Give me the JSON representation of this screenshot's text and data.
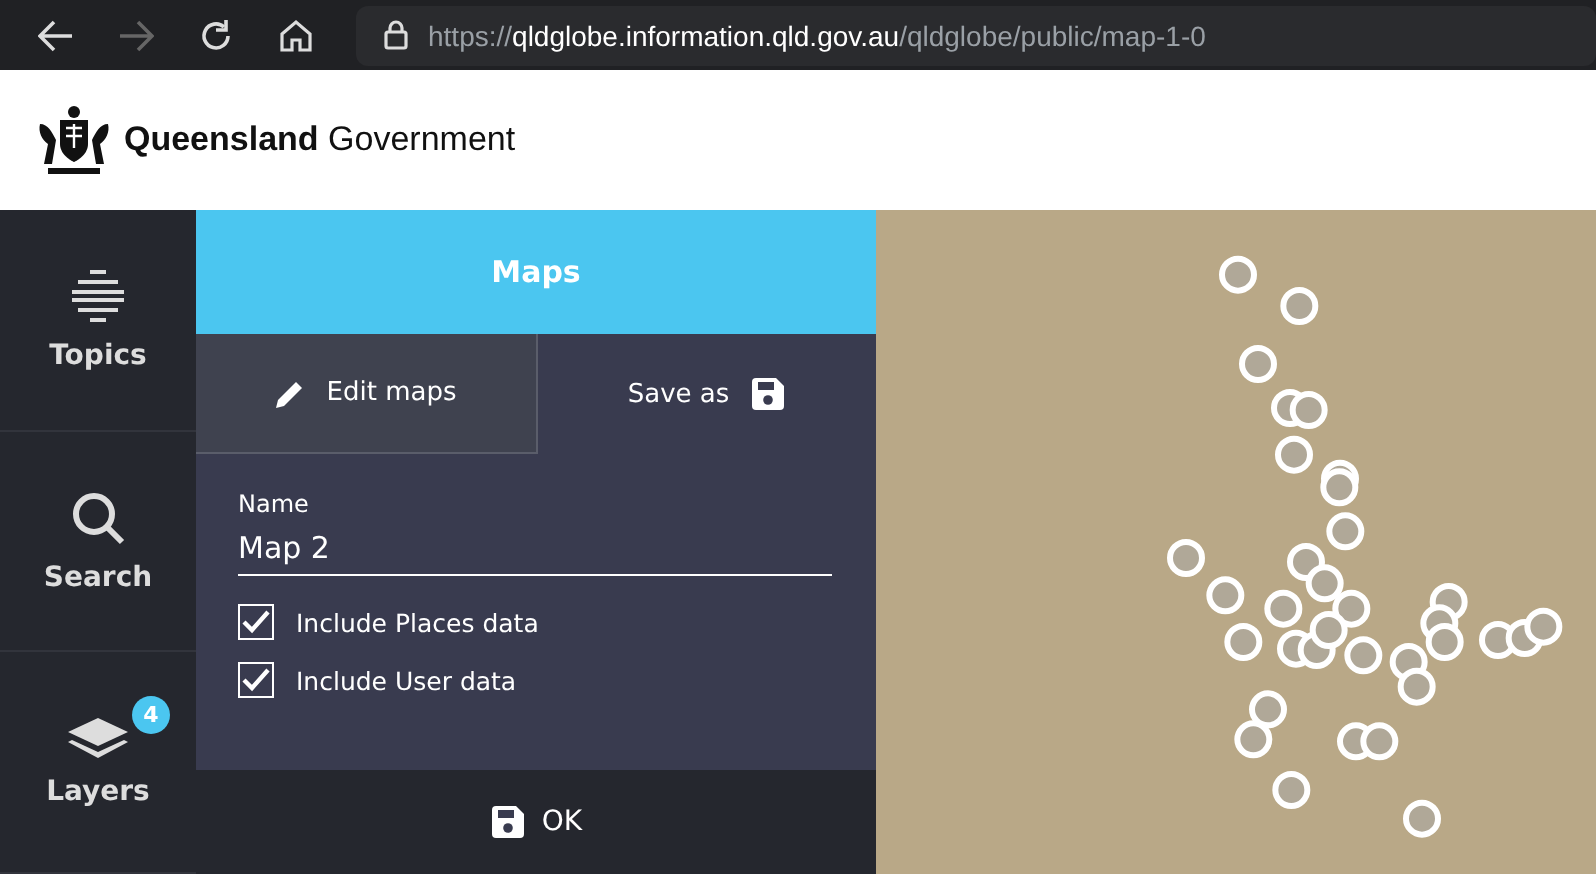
{
  "browser": {
    "url": "https://**qldglobe.information.qld.gov.au**/qldglobe/public/map-1-0",
    "forward_disabled": true
  },
  "header": {
    "brand_bold": "Queensland",
    "brand_light": "Government"
  },
  "nav": [
    {
      "kind": "topics",
      "label": "Topics"
    },
    {
      "kind": "search",
      "label": "Search"
    },
    {
      "kind": "layers",
      "label": "Layers",
      "badge": "4"
    }
  ],
  "panel": {
    "title": "Maps",
    "tabs": [
      {
        "kind": "edit",
        "label": "Edit maps",
        "selected": true
      },
      {
        "kind": "save",
        "label": "Save as",
        "selected": false
      }
    ],
    "name_label": "Name",
    "name_value": "Map 2",
    "options": [
      {
        "label": "Include Places data",
        "checked": true
      },
      {
        "label": "Include User data",
        "checked": true
      }
    ],
    "ok_button": "OK"
  }
}
